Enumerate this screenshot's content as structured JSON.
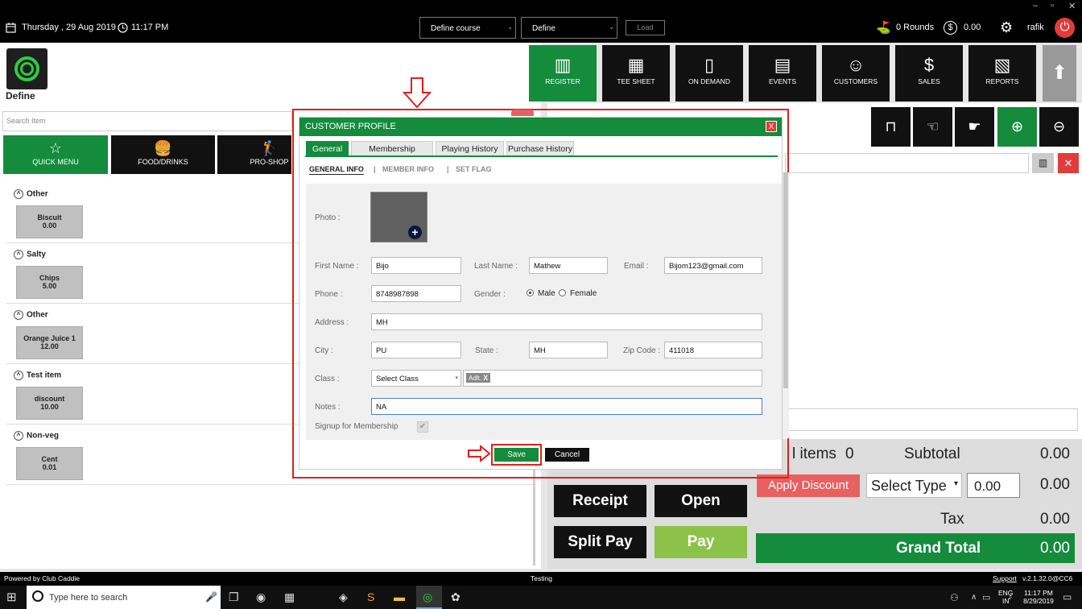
{
  "window": {
    "minimize": "–",
    "restore": "▫",
    "close": "✕"
  },
  "topbar": {
    "date": "Thursday , 29 Aug 2019",
    "time": "11:17 PM",
    "course": "Define course",
    "define": "Define",
    "load": "Load",
    "rounds": "0 Rounds",
    "amount": "0.00",
    "user": "rafik"
  },
  "left": {
    "brand": "Define",
    "search_placeholder": "Search Item",
    "categories": [
      {
        "label": "QUICK MENU",
        "icon": "star-icon"
      },
      {
        "label": "FOOD/DRINKS",
        "icon": "food-icon"
      },
      {
        "label": "PRO-SHOP",
        "icon": "golf-icon"
      }
    ],
    "groups": [
      {
        "name": "Other",
        "item": "Biscuit",
        "price": "0.00"
      },
      {
        "name": "Salty",
        "item": "Chips",
        "price": "5.00"
      },
      {
        "name": "Other",
        "item": "Orange Juice 1",
        "price": "12.00"
      },
      {
        "name": "Test item",
        "item": "discount",
        "price": "10.00"
      },
      {
        "name": "Non-veg",
        "item": "Cent",
        "price": "0.01"
      }
    ]
  },
  "nav": [
    {
      "label": "REGISTER",
      "icon": "barcode-scanner-icon",
      "color": "#148c3c"
    },
    {
      "label": "TEE SHEET",
      "icon": "calendar-icon"
    },
    {
      "label": "ON DEMAND",
      "icon": "mobile-icon"
    },
    {
      "label": "EVENTS",
      "icon": "events-icon"
    },
    {
      "label": "CUSTOMERS",
      "icon": "customers-icon"
    },
    {
      "label": "SALES",
      "icon": "sales-icon"
    },
    {
      "label": "REPORTS",
      "icon": "reports-icon"
    }
  ],
  "summary": {
    "items_label": "l items",
    "items_count": "0",
    "subtotal_label": "Subtotal",
    "subtotal": "0.00",
    "apply_discount": "Apply Discount",
    "select_type": "Select Type",
    "discount_value": "0.00",
    "discount": "0.00",
    "tax_label": "Tax",
    "tax": "0.00",
    "grand_total_label": "Grand Total",
    "grand_total": "0.00",
    "receipt": "Receipt",
    "open": "Open",
    "split_pay": "Split Pay",
    "pay": "Pay"
  },
  "modal": {
    "title": "CUSTOMER PROFILE",
    "close": "X",
    "tabs": [
      "General",
      "Membership",
      "Playing History",
      "Purchase History"
    ],
    "subtabs": [
      "GENERAL INFO",
      "MEMBER INFO",
      "SET FLAG"
    ],
    "subtab_sep": "|",
    "fields": {
      "photo_label": "Photo :",
      "first_name_label": "First Name :",
      "first_name": "Bijo",
      "last_name_label": "Last Name :",
      "last_name": "Mathew",
      "email_label": "Email :",
      "email": "Bijom123@gmail.com",
      "phone_label": "Phone :",
      "phone": "8748987898",
      "gender_label": "Gender :",
      "male": "Male",
      "female": "Female",
      "address_label": "Address :",
      "address": "MH",
      "city_label": "City :",
      "city": "PU",
      "state_label": "State :",
      "state": "MH",
      "zip_label": "Zip Code :",
      "zip": "411018",
      "class_label": "Class :",
      "class_select": "Select Class",
      "class_tag": "Adlt.",
      "class_tag_x": "X",
      "notes_label": "Notes :",
      "notes": "NA",
      "signup_label": "Signup for Membership"
    },
    "save": "Save",
    "cancel": "Cancel"
  },
  "status": {
    "powered": "Powered by Club Caddie",
    "env": "Testing",
    "support": "Support",
    "version": "v.2.1.32.0@CC6"
  },
  "taskbar": {
    "search": "Type here to search",
    "lang1": "ENG",
    "lang2": "IN",
    "time": "11:17 PM",
    "date": "8/29/2019"
  },
  "colors": {
    "green": "#148c3c",
    "red": "#e23b3b",
    "light_green": "#8bc34a",
    "annotation": "#e02020"
  }
}
